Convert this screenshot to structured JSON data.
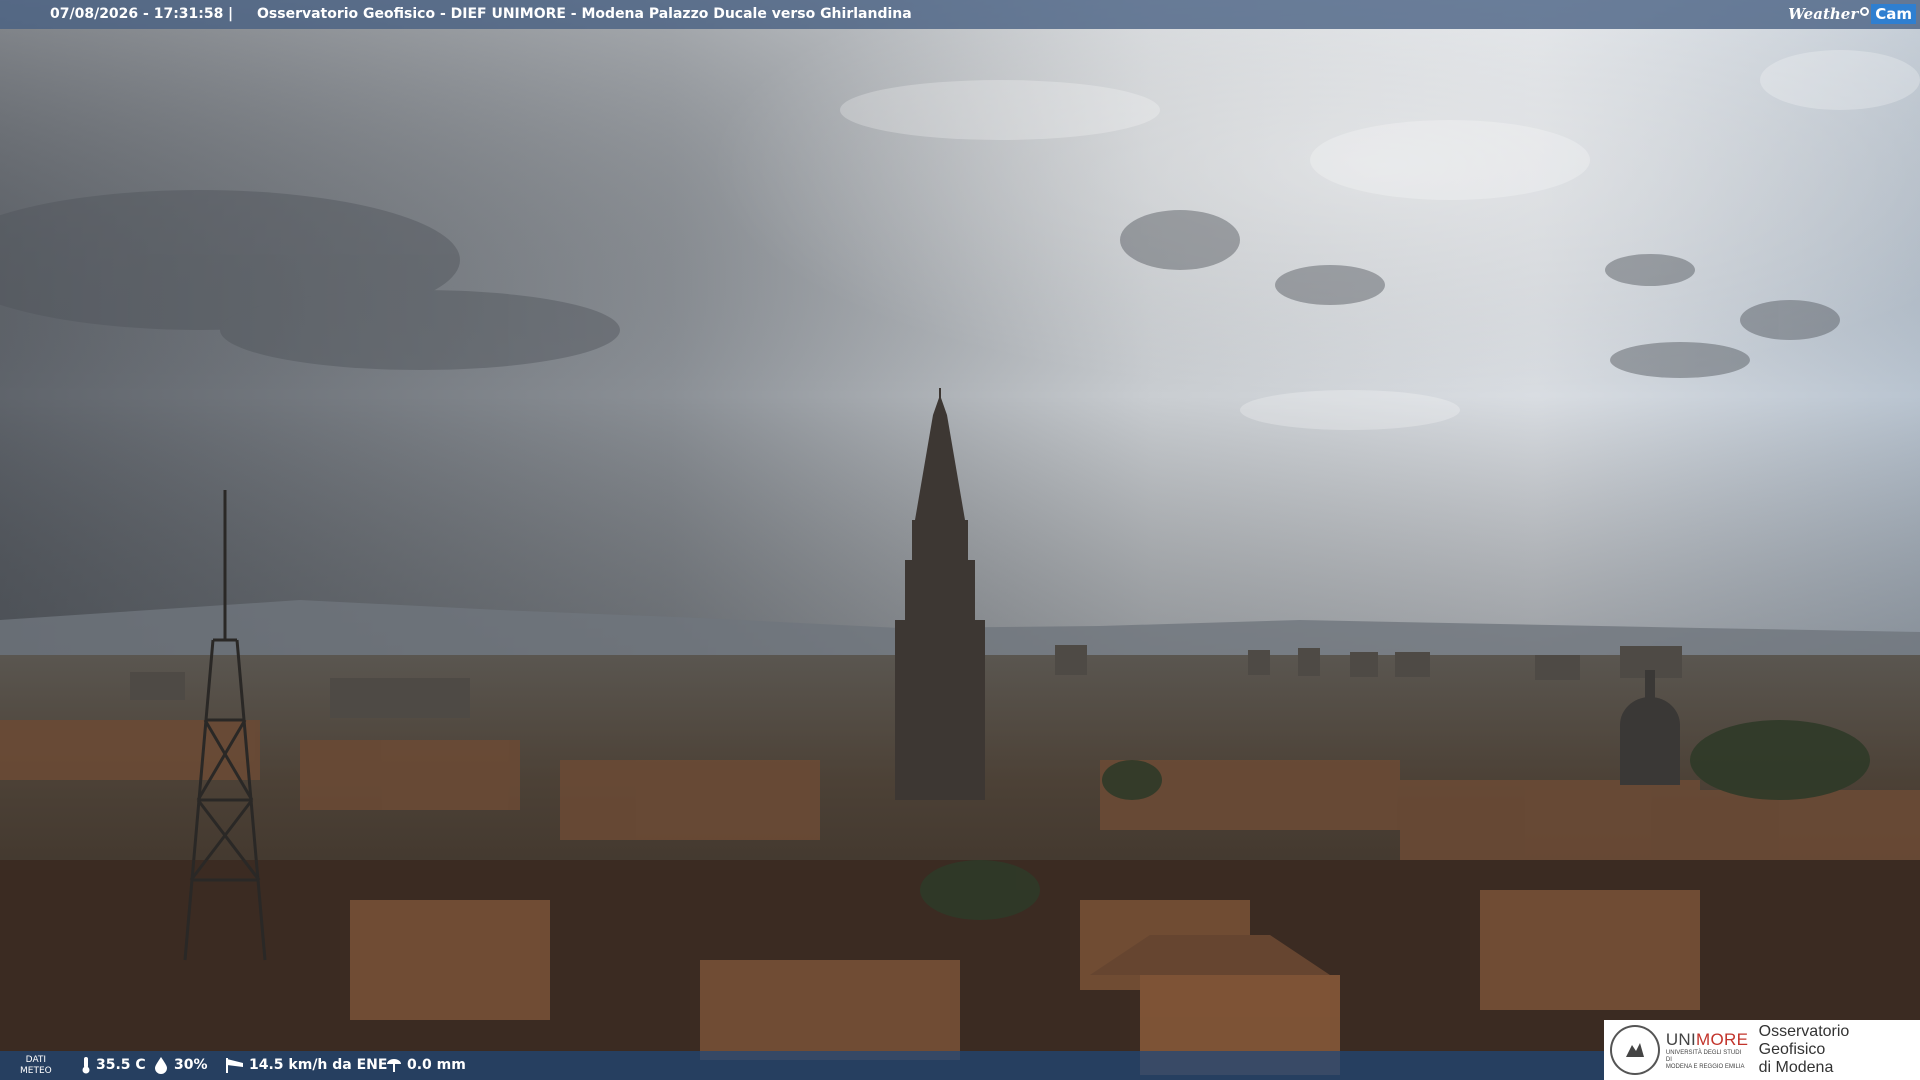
{
  "overlay": {
    "timestamp": "07/08/2026 - 17:31:58",
    "separator": "|",
    "title": "Osservatorio Geofisico - DIEF UNIMORE - Modena Palazzo Ducale verso Ghirlandina",
    "brand_weather": "Weather",
    "brand_cam": "Cam"
  },
  "weather_bar": {
    "label_line1": "DATI",
    "label_line2": "METEO",
    "temperature": "35.5 C",
    "humidity": "30%",
    "wind": "14.5 km/h da ENE",
    "rain": "0.0 mm",
    "icons": [
      "thermometer-icon",
      "humidity-drop-icon",
      "wind-sock-icon",
      "rain-gauge-icon"
    ]
  },
  "logo": {
    "uni_prefix": "UNI",
    "uni_suffix": "MORE",
    "uni_sub1": "UNIVERSITÀ DEGLI STUDI DI",
    "uni_sub2": "MODENA E REGGIO EMILIA",
    "obs_line1": "Osservatorio Geofisico",
    "obs_line2": "di Modena"
  },
  "colors": {
    "accent_red": "#c2342b",
    "bar_blue": "#1e4678",
    "cam_blue": "#2f7fd0"
  }
}
